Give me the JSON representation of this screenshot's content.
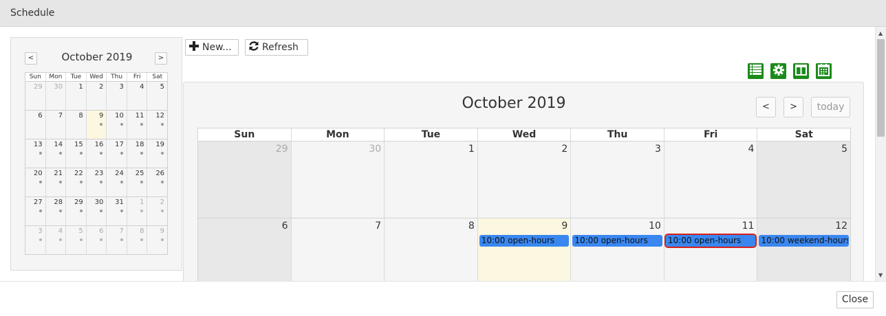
{
  "window": {
    "title": "Schedule"
  },
  "toolbar": {
    "new_label": "New...",
    "refresh_label": "Refresh",
    "view_icons": [
      "list-view-icon",
      "settings-gear-icon",
      "columns-view-icon",
      "month-calendar-icon"
    ]
  },
  "mini_calendar": {
    "title": "October 2019",
    "prev_label": "<",
    "next_label": ">",
    "weekdays": [
      "Sun",
      "Mon",
      "Tue",
      "Wed",
      "Thu",
      "Fri",
      "Sat"
    ],
    "weeks": [
      [
        {
          "d": "29",
          "other": true,
          "dot": false
        },
        {
          "d": "30",
          "other": true,
          "dot": false
        },
        {
          "d": "1",
          "other": false,
          "dot": false
        },
        {
          "d": "2",
          "other": false,
          "dot": false
        },
        {
          "d": "3",
          "other": false,
          "dot": false
        },
        {
          "d": "4",
          "other": false,
          "dot": false
        },
        {
          "d": "5",
          "other": false,
          "dot": false
        }
      ],
      [
        {
          "d": "6",
          "other": false,
          "dot": false
        },
        {
          "d": "7",
          "other": false,
          "dot": false
        },
        {
          "d": "8",
          "other": false,
          "dot": false
        },
        {
          "d": "9",
          "other": false,
          "dot": true,
          "today": true
        },
        {
          "d": "10",
          "other": false,
          "dot": true
        },
        {
          "d": "11",
          "other": false,
          "dot": true
        },
        {
          "d": "12",
          "other": false,
          "dot": true
        }
      ],
      [
        {
          "d": "13",
          "other": false,
          "dot": true
        },
        {
          "d": "14",
          "other": false,
          "dot": true
        },
        {
          "d": "15",
          "other": false,
          "dot": true
        },
        {
          "d": "16",
          "other": false,
          "dot": true
        },
        {
          "d": "17",
          "other": false,
          "dot": true
        },
        {
          "d": "18",
          "other": false,
          "dot": true
        },
        {
          "d": "19",
          "other": false,
          "dot": true
        }
      ],
      [
        {
          "d": "20",
          "other": false,
          "dot": true
        },
        {
          "d": "21",
          "other": false,
          "dot": true
        },
        {
          "d": "22",
          "other": false,
          "dot": true
        },
        {
          "d": "23",
          "other": false,
          "dot": true
        },
        {
          "d": "24",
          "other": false,
          "dot": true
        },
        {
          "d": "25",
          "other": false,
          "dot": true
        },
        {
          "d": "26",
          "other": false,
          "dot": true
        }
      ],
      [
        {
          "d": "27",
          "other": false,
          "dot": true
        },
        {
          "d": "28",
          "other": false,
          "dot": true
        },
        {
          "d": "29",
          "other": false,
          "dot": true
        },
        {
          "d": "30",
          "other": false,
          "dot": true
        },
        {
          "d": "31",
          "other": false,
          "dot": true
        },
        {
          "d": "1",
          "other": true,
          "dot": true
        },
        {
          "d": "2",
          "other": true,
          "dot": true
        }
      ],
      [
        {
          "d": "3",
          "other": true,
          "dot": true
        },
        {
          "d": "4",
          "other": true,
          "dot": true
        },
        {
          "d": "5",
          "other": true,
          "dot": true
        },
        {
          "d": "6",
          "other": true,
          "dot": true
        },
        {
          "d": "7",
          "other": true,
          "dot": true
        },
        {
          "d": "8",
          "other": true,
          "dot": true
        },
        {
          "d": "9",
          "other": true,
          "dot": true
        }
      ]
    ]
  },
  "main_calendar": {
    "title": "October 2019",
    "prev_label": "<",
    "next_label": ">",
    "today_label": "today",
    "weekdays": [
      "Sun",
      "Mon",
      "Tue",
      "Wed",
      "Thu",
      "Fri",
      "Sat"
    ],
    "week1": [
      "29",
      "30",
      "1",
      "2",
      "3",
      "4",
      "5"
    ],
    "week2": [
      "6",
      "7",
      "8",
      "9",
      "10",
      "11",
      "12"
    ],
    "events": {
      "wed": "10:00 open-hours",
      "thu": "10:00 open-hours",
      "fri": "10:00 open-hours",
      "sat": "10:00 weekend-hours"
    }
  },
  "footer": {
    "close_label": "Close"
  }
}
